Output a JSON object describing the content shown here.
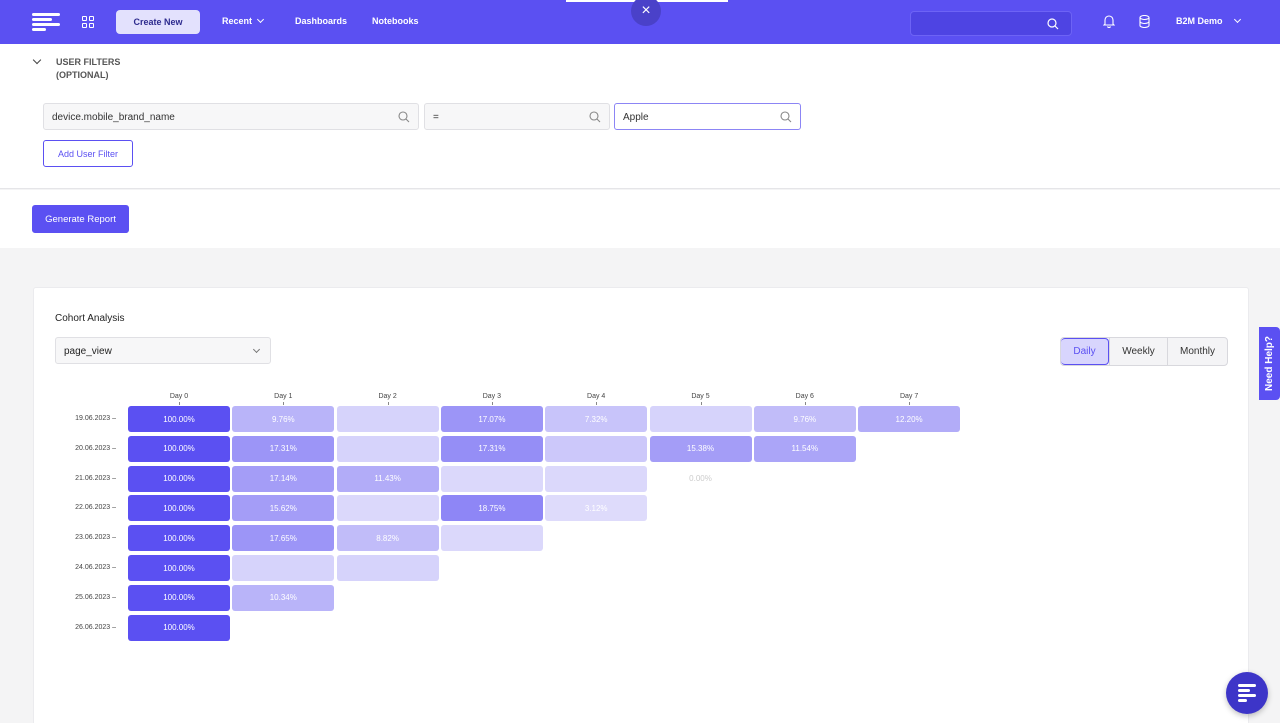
{
  "nav": {
    "create_label": "Create New",
    "recent_label": "Recent",
    "dashboards_label": "Dashboards",
    "notebooks_label": "Notebooks",
    "user_label": "B2M Demo",
    "search_placeholder": ""
  },
  "filters": {
    "section_title_line1": "USER FILTERS",
    "section_title_line2": "(OPTIONAL)",
    "property_value": "device.mobile_brand_name",
    "operator_value": "=",
    "match_value": "Apple",
    "add_filter_label": "Add User Filter"
  },
  "generate_label": "Generate Report",
  "cohort": {
    "title": "Cohort Analysis",
    "event_select": "page_view",
    "periods": [
      "Daily",
      "Weekly",
      "Monthly"
    ],
    "selected_period": "Daily",
    "columns": [
      "Day 0",
      "Day 1",
      "Day 2",
      "Day 3",
      "Day 4",
      "Day 5",
      "Day 6",
      "Day 7"
    ],
    "rows": [
      {
        "date": "19.06.2023",
        "cells": [
          "100.00%",
          "9.76%",
          "",
          "17.07%",
          "7.32%",
          "",
          "9.76%",
          "12.20%"
        ]
      },
      {
        "date": "20.06.2023",
        "cells": [
          "100.00%",
          "17.31%",
          "",
          "17.31%",
          "",
          "15.38%",
          "11.54%"
        ]
      },
      {
        "date": "21.06.2023",
        "cells": [
          "100.00%",
          "17.14%",
          "11.43%",
          "",
          "",
          "0.00%"
        ]
      },
      {
        "date": "22.06.2023",
        "cells": [
          "100.00%",
          "15.62%",
          "",
          "18.75%",
          "3.12%"
        ]
      },
      {
        "date": "23.06.2023",
        "cells": [
          "100.00%",
          "17.65%",
          "8.82%",
          ""
        ]
      },
      {
        "date": "24.06.2023",
        "cells": [
          "100.00%",
          "",
          ""
        ]
      },
      {
        "date": "25.06.2023",
        "cells": [
          "100.00%",
          "10.34%"
        ]
      },
      {
        "date": "26.06.2023",
        "cells": [
          "100.00%"
        ]
      }
    ],
    "levels": [
      [
        1,
        0.35,
        0.15,
        0.55,
        0.25,
        0.15,
        0.3,
        0.4
      ],
      [
        1,
        0.55,
        0.15,
        0.6,
        0.22,
        0.5,
        0.45
      ],
      [
        1,
        0.5,
        0.4,
        0.12,
        0.12,
        0
      ],
      [
        1,
        0.5,
        0.12,
        0.65,
        0.1
      ],
      [
        1,
        0.55,
        0.3,
        0.12
      ],
      [
        1,
        0.15,
        0.15
      ],
      [
        1,
        0.35
      ],
      [
        1
      ]
    ],
    "accent": "#5b50f2"
  },
  "help_label": "Need Help?"
}
